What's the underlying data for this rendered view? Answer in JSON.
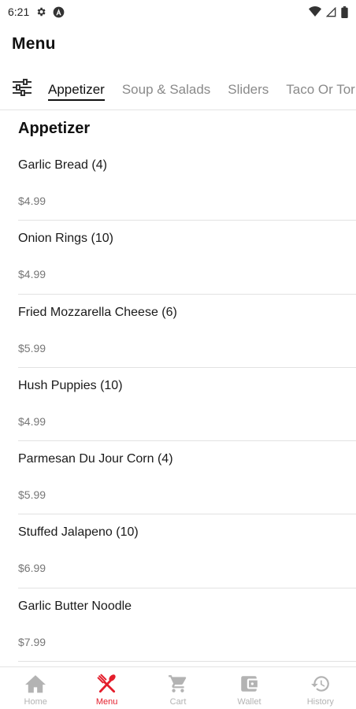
{
  "status_bar": {
    "time": "6:21"
  },
  "header": {
    "title": "Menu"
  },
  "tabs": [
    {
      "label": "Appetizer",
      "active": true
    },
    {
      "label": "Soup & Salads",
      "active": false
    },
    {
      "label": "Sliders",
      "active": false
    },
    {
      "label": "Taco Or Tor",
      "active": false
    }
  ],
  "section": {
    "title": "Appetizer",
    "items": [
      {
        "name": "Garlic Bread (4)",
        "price": "$4.99"
      },
      {
        "name": "Onion Rings (10)",
        "price": "$4.99"
      },
      {
        "name": "Fried Mozzarella Cheese (6)",
        "price": "$5.99"
      },
      {
        "name": "Hush Puppies (10)",
        "price": "$4.99"
      },
      {
        "name": "Parmesan Du Jour Corn (4)",
        "price": "$5.99"
      },
      {
        "name": "Stuffed Jalapeno (10)",
        "price": "$6.99"
      },
      {
        "name": "Garlic Butter Noodle",
        "price": "$7.99"
      }
    ]
  },
  "bottom_nav": [
    {
      "label": "Home",
      "icon": "home-icon",
      "active": false
    },
    {
      "label": "Menu",
      "icon": "fork-knife-icon",
      "active": true
    },
    {
      "label": "Cart",
      "icon": "cart-icon",
      "active": false
    },
    {
      "label": "Wallet",
      "icon": "wallet-icon",
      "active": false
    },
    {
      "label": "History",
      "icon": "history-icon",
      "active": false
    }
  ],
  "colors": {
    "accent": "#e41d2b",
    "inactive": "#b3b3b3",
    "text": "#111111",
    "muted": "#777777"
  }
}
